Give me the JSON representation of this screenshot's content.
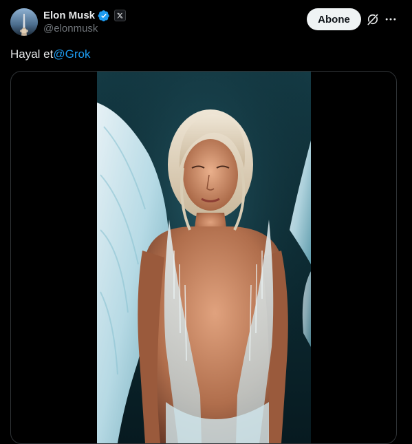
{
  "tweet": {
    "author": {
      "name": "Elon Musk",
      "handle": "@elonmusk",
      "verified": true,
      "affiliate_badge_icon": "x-logo-icon"
    },
    "actions": {
      "subscribe_label": "Abone",
      "grok_icon": "grok-icon",
      "more_icon": "more-icon"
    },
    "text_plain": "Hayal et",
    "mention": "@Grok",
    "media": {
      "kind": "image",
      "alt": "Image"
    }
  },
  "colors": {
    "background": "#000000",
    "text": "#e7e9ea",
    "muted": "#71767b",
    "link": "#1d9bf0",
    "verified": "#1d9bf0",
    "button_bg": "#eff3f4"
  }
}
